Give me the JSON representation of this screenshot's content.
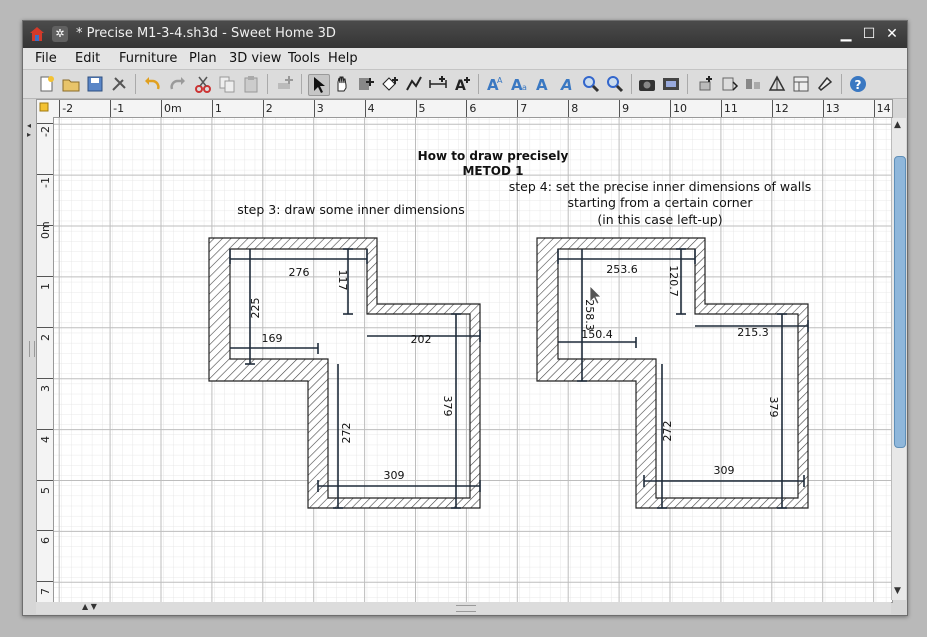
{
  "window": {
    "title": "* Precise M1-3-4.sh3d - Sweet Home 3D"
  },
  "menubar": {
    "items": [
      "File",
      "Edit",
      "Furniture",
      "Plan",
      "3D view",
      "Tools",
      "Help"
    ]
  },
  "toolbar": {
    "icons": [
      "new-home-icon",
      "open-icon",
      "save-icon",
      "preferences-icon",
      "undo-icon",
      "redo-icon",
      "cut-icon",
      "copy-icon",
      "paste-icon",
      "add-furniture-icon",
      "select-mode-icon",
      "pan-mode-icon",
      "create-walls-icon",
      "create-rooms-icon",
      "create-polylines-icon",
      "create-dimensions-icon",
      "create-labels-icon",
      "increase-text-size-icon",
      "decrease-text-size-icon",
      "bold-text-icon",
      "italic-text-icon",
      "zoom-in-icon",
      "zoom-out-icon",
      "create-photo-icon",
      "create-video-icon",
      "import-furniture-icon",
      "import-texture-icon",
      "flip-horizontally-icon",
      "flip-vertically-icon",
      "export-icon",
      "help-icon"
    ]
  },
  "rulers": {
    "horizontal": [
      "-2",
      "-1",
      "0m",
      "1",
      "2",
      "3",
      "4",
      "5",
      "6",
      "7",
      "8",
      "9",
      "10",
      "11",
      "12",
      "13",
      "14"
    ],
    "vertical": [
      "-2",
      "-1",
      "0m",
      "1",
      "2",
      "3",
      "4",
      "5",
      "6",
      "7"
    ]
  },
  "plan": {
    "heading": {
      "line1": "How to draw precisely",
      "line2": "METOD 1"
    },
    "step3": "step 3: draw some inner dimensions",
    "step4": {
      "line1": "step 4: set the precise inner dimensions of walls",
      "line2": "starting from a certain corner",
      "line3": "(in this case left-up)"
    },
    "left_dims": [
      "276",
      "117",
      "225",
      "169",
      "202",
      "379",
      "272",
      "309"
    ],
    "right_dims": [
      "253.6",
      "120.7",
      "258.3",
      "150.4",
      "215.3",
      "379",
      "272",
      "309"
    ]
  }
}
